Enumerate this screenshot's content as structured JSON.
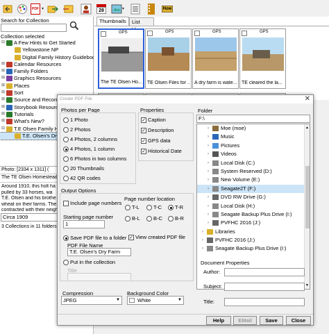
{
  "toolbar": {
    "icons": [
      "back-icon",
      "palette-icon",
      "pdf-icon",
      "export-icon",
      "move-icon",
      "person-icon",
      "calendar-icon",
      "map-icon",
      "checklist-icon",
      "film-icon",
      "howto-icon"
    ],
    "calendar_day": "28",
    "howto_label": "How",
    "pdf_label": "PDF"
  },
  "left": {
    "search_label": "Search for Collection",
    "collection_selected": "Collection selected",
    "tree": [
      {
        "label": "A Few Hints to Get Started",
        "level": 0,
        "toggle": "⊟",
        "color": "#2a7a2a"
      },
      {
        "label": "Yellowstone NP",
        "level": 1,
        "toggle": "",
        "color": "#d9b02c"
      },
      {
        "label": "Digital Family History Guidebook",
        "level": 1,
        "toggle": "",
        "color": "#d9b02c"
      },
      {
        "label": "Calendar Resources",
        "level": 0,
        "toggle": "⊞",
        "color": "#c0392b"
      },
      {
        "label": "Family Folders",
        "level": 0,
        "toggle": "⊞",
        "color": "#2a66b8"
      },
      {
        "label": "Graphics Resources",
        "level": 0,
        "toggle": "⊞",
        "color": "#7b3fa0"
      },
      {
        "label": "Places",
        "level": 0,
        "toggle": "⊞",
        "color": "#d9b02c"
      },
      {
        "label": "Sort",
        "level": 0,
        "toggle": "⊞",
        "color": "#c0392b"
      },
      {
        "label": "Source and Record",
        "level": 0,
        "toggle": "⊞",
        "color": "#2a7a2a"
      },
      {
        "label": "Storybook Resource",
        "level": 0,
        "toggle": "⊞",
        "color": "#2a66b8"
      },
      {
        "label": "Tutorials",
        "level": 0,
        "toggle": "⊞",
        "color": "#2a7a2a"
      },
      {
        "label": "What's New?",
        "level": 0,
        "toggle": "⊞",
        "color": "#c0392b"
      },
      {
        "label": "T.E Olsen Family H",
        "level": 0,
        "toggle": "⊟",
        "color": "#d9b02c"
      },
      {
        "label": "T.E. Olsen's Dry",
        "level": 1,
        "toggle": "",
        "color": "#d9b02c",
        "selected": true
      }
    ],
    "photo_info": "Photo: [2334 x 1311] (",
    "photo_title": "The TE Olsen Homestead",
    "description": [
      "Around 1910, this holt ha",
      "pulled by 33 horses, wa",
      "T.E. Olsen and his brothe",
      "wheat on their farms. The",
      "contracted with their neigh"
    ],
    "date": "Circa 1909",
    "status": "3 Collections in 11 folders"
  },
  "right": {
    "tabs": [
      "Thumbnails",
      "List View"
    ],
    "thumbs": [
      {
        "gps": "GPS",
        "caption": "The TE Olsen Ho...",
        "selected": true
      },
      {
        "gps": "GPS",
        "caption": "TE Olsen Files for ..."
      },
      {
        "gps": "GPS",
        "caption": "A dry farm is wate..."
      },
      {
        "gps": "GPS",
        "caption": "TE cleared the la..."
      }
    ]
  },
  "dialog": {
    "title": "Create PDF File",
    "close": "✕",
    "photos_per_page": {
      "label": "Photos per Page",
      "options": [
        "1 Photo",
        "2 Photos",
        "4 Photos, 2 columns",
        "4 Photos, 1 column",
        "6 Photos in two columns",
        "20 Thumbnails",
        "42 QR codes"
      ],
      "selected": 3
    },
    "properties": {
      "label": "Properties",
      "items": [
        {
          "label": "Caption",
          "checked": true
        },
        {
          "label": "Description",
          "checked": true
        },
        {
          "label": "GPS data",
          "checked": true
        },
        {
          "label": "Historical Date",
          "checked": true
        }
      ]
    },
    "folder": {
      "label": "Folder",
      "path": "F:\\",
      "items": [
        {
          "label": "Moe (moe)",
          "indent": 2,
          "color": "#8a6d3b"
        },
        {
          "label": "Music",
          "indent": 2,
          "color": "#2a66b8"
        },
        {
          "label": "Pictures",
          "indent": 2,
          "color": "#4a90d9"
        },
        {
          "label": "Videos",
          "indent": 2,
          "color": "#555"
        },
        {
          "label": "Local Disk (C:)",
          "indent": 2,
          "color": "#888"
        },
        {
          "label": "System Reserved (D:)",
          "indent": 2,
          "color": "#888"
        },
        {
          "label": "New Volume (E:)",
          "indent": 2,
          "color": "#888"
        },
        {
          "label": "Seagate2T (F:)",
          "indent": 2,
          "color": "#888",
          "selected": true
        },
        {
          "label": "DVD RW Drive (G:)",
          "indent": 2,
          "color": "#666"
        },
        {
          "label": "Local Disk (H:)",
          "indent": 2,
          "color": "#888"
        },
        {
          "label": "Seagate Backup Plus Drive (I:)",
          "indent": 2,
          "color": "#888"
        },
        {
          "label": "PVFHC 2016 (J:)",
          "indent": 2,
          "color": "#666"
        },
        {
          "label": "Libraries",
          "indent": 1,
          "color": "#d9b02c"
        },
        {
          "label": "PVFHC 2016 (J:)",
          "indent": 1,
          "color": "#666"
        },
        {
          "label": "Seagate Backup Plus Drive (I:)",
          "indent": 1,
          "color": "#888"
        }
      ]
    },
    "output_options": {
      "label": "Output Options",
      "include_page_numbers": "Include page numbers",
      "starting_page_label": "Starting page number",
      "starting_page": "1",
      "page_number_location": "Page number location",
      "locations": [
        "T-L",
        "T-C",
        "T-R",
        "B-L",
        "B-C",
        "B-R"
      ],
      "location_selected": 2
    },
    "save_pdf": {
      "label": "Save PDF file to a folder",
      "view_created": "View created PDF file",
      "file_name_label": "PDF File Name",
      "file_name": "T.E. Olsen's Dry Farm",
      "put_in_collection": "Put in the collection",
      "title_label": "Title"
    },
    "compression": {
      "label": "Compression",
      "value": "JPEG"
    },
    "background": {
      "label": "Background Color",
      "value": "White",
      "swatch": "#ffffff"
    },
    "doc_props": {
      "label": "Document Properties",
      "author": "Author:",
      "subject": "Subject:",
      "title": "Title:"
    },
    "buttons": {
      "help": "Help",
      "email": "EMail",
      "save": "Save",
      "close": "Close"
    }
  }
}
